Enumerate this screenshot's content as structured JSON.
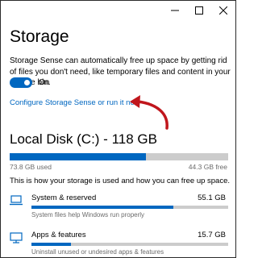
{
  "page": {
    "title": "Storage",
    "description": "Storage Sense can automatically free up space by getting rid of files you don't need, like temporary files and content in your recycle bin.",
    "toggle_state": "On",
    "config_link": "Configure Storage Sense or run it now"
  },
  "disk": {
    "title": "Local Disk (C:) - 118 GB",
    "used": "73.8 GB used",
    "free": "44.3 GB free",
    "used_fraction": 0.625
  },
  "info": "This is how your storage is used and how you can free up space.",
  "categories": [
    {
      "name": "System & reserved",
      "size": "55.1 GB",
      "subtitle": "System files help Windows run properly",
      "fill_fraction": 0.72,
      "icon": "laptop-icon"
    },
    {
      "name": "Apps & features",
      "size": "15.7 GB",
      "subtitle": "Uninstall unused or undesired apps & features",
      "fill_fraction": 0.2,
      "icon": "monitor-icon"
    }
  ],
  "colors": {
    "accent": "#0067c0",
    "bar_track": "#cccccc",
    "annotation_arrow": "#c0161c"
  }
}
